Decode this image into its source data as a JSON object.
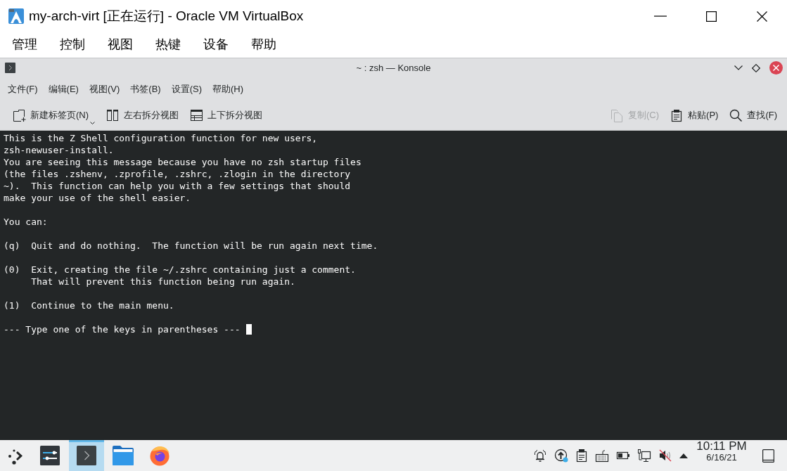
{
  "window": {
    "title": "my-arch-virt [正在运行] - Oracle VM VirtualBox"
  },
  "menu_bar": [
    "管理",
    "控制",
    "视图",
    "热键",
    "设备",
    "帮助"
  ],
  "konsole": {
    "title": "~ : zsh — Konsole",
    "menu_bar": [
      "文件(F)",
      "编辑(E)",
      "视图(V)",
      "书签(B)",
      "设置(S)",
      "帮助(H)"
    ],
    "toolbar_left": [
      {
        "label": "新建标签页(N)",
        "kind": "dropdown",
        "disabled": false
      },
      {
        "label": "左右拆分视图",
        "kind": "button",
        "disabled": false
      },
      {
        "label": "上下拆分视图",
        "kind": "button",
        "disabled": false
      }
    ],
    "toolbar_right": [
      {
        "label": "复制(C)",
        "disabled": true
      },
      {
        "label": "粘贴(P)",
        "disabled": false
      },
      {
        "label": "查找(F)",
        "disabled": false
      }
    ],
    "terminal": {
      "paragraphs": [
        [
          "This is the Z Shell configuration function for new users,",
          "zsh-newuser-install.",
          "You are seeing this message because you have no zsh startup files",
          "(the files .zshenv, .zprofile, .zshrc, .zlogin in the directory",
          "~).  This function can help you with a few settings that should",
          "make your use of the shell easier."
        ],
        [
          "You can:"
        ],
        [
          "(q)  Quit and do nothing.  The function will be run again next time."
        ],
        [
          "(0)  Exit, creating the file ~/.zshrc containing just a comment.",
          "     That will prevent this function being run again."
        ],
        [
          "(1)  Continue to the main menu."
        ],
        [
          "--- Type one of the keys in parentheses ---"
        ]
      ]
    }
  },
  "taskbar": {
    "tasks": [
      {
        "selected": false
      },
      {
        "selected": true
      },
      {
        "selected": false
      },
      {
        "selected": false
      }
    ],
    "clock": {
      "time": "10:11 PM",
      "date": "6/16/21"
    }
  }
}
